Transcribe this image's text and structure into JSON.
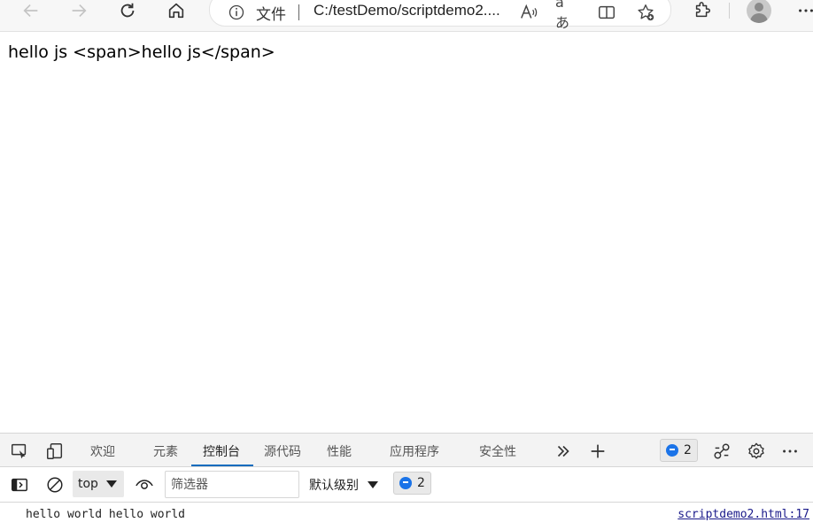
{
  "browser": {
    "address_prefix": "文件",
    "url": "C:/testDemo/scriptdemo2....",
    "translate_glyph": "aあ",
    "icons": [
      "back-icon",
      "forward-icon",
      "refresh-icon",
      "home-icon",
      "info-icon",
      "read-aloud-icon",
      "translate-icon",
      "split-screen-icon",
      "add-favorite-icon",
      "extensions-icon",
      "profile-icon",
      "more-icon"
    ]
  },
  "page": {
    "text": "hello js <span>hello js</span>"
  },
  "devtools": {
    "tabs": [
      {
        "label": "欢迎"
      },
      {
        "label": "元素"
      },
      {
        "label": "控制台"
      },
      {
        "label": "源代码"
      },
      {
        "label": "性能"
      },
      {
        "label": "应用程序"
      },
      {
        "label": "安全性"
      }
    ],
    "active_tab": "控制台",
    "issues_count": "2",
    "console": {
      "context": "top",
      "filter_placeholder": "筛选器",
      "level": "默认级别",
      "message_count": "2",
      "messages": [
        {
          "text": "hello world hello world",
          "source": "scriptdemo2.html:17"
        }
      ]
    },
    "accent_color": "#0f6cbd",
    "badge_color": "#1a73e8"
  }
}
